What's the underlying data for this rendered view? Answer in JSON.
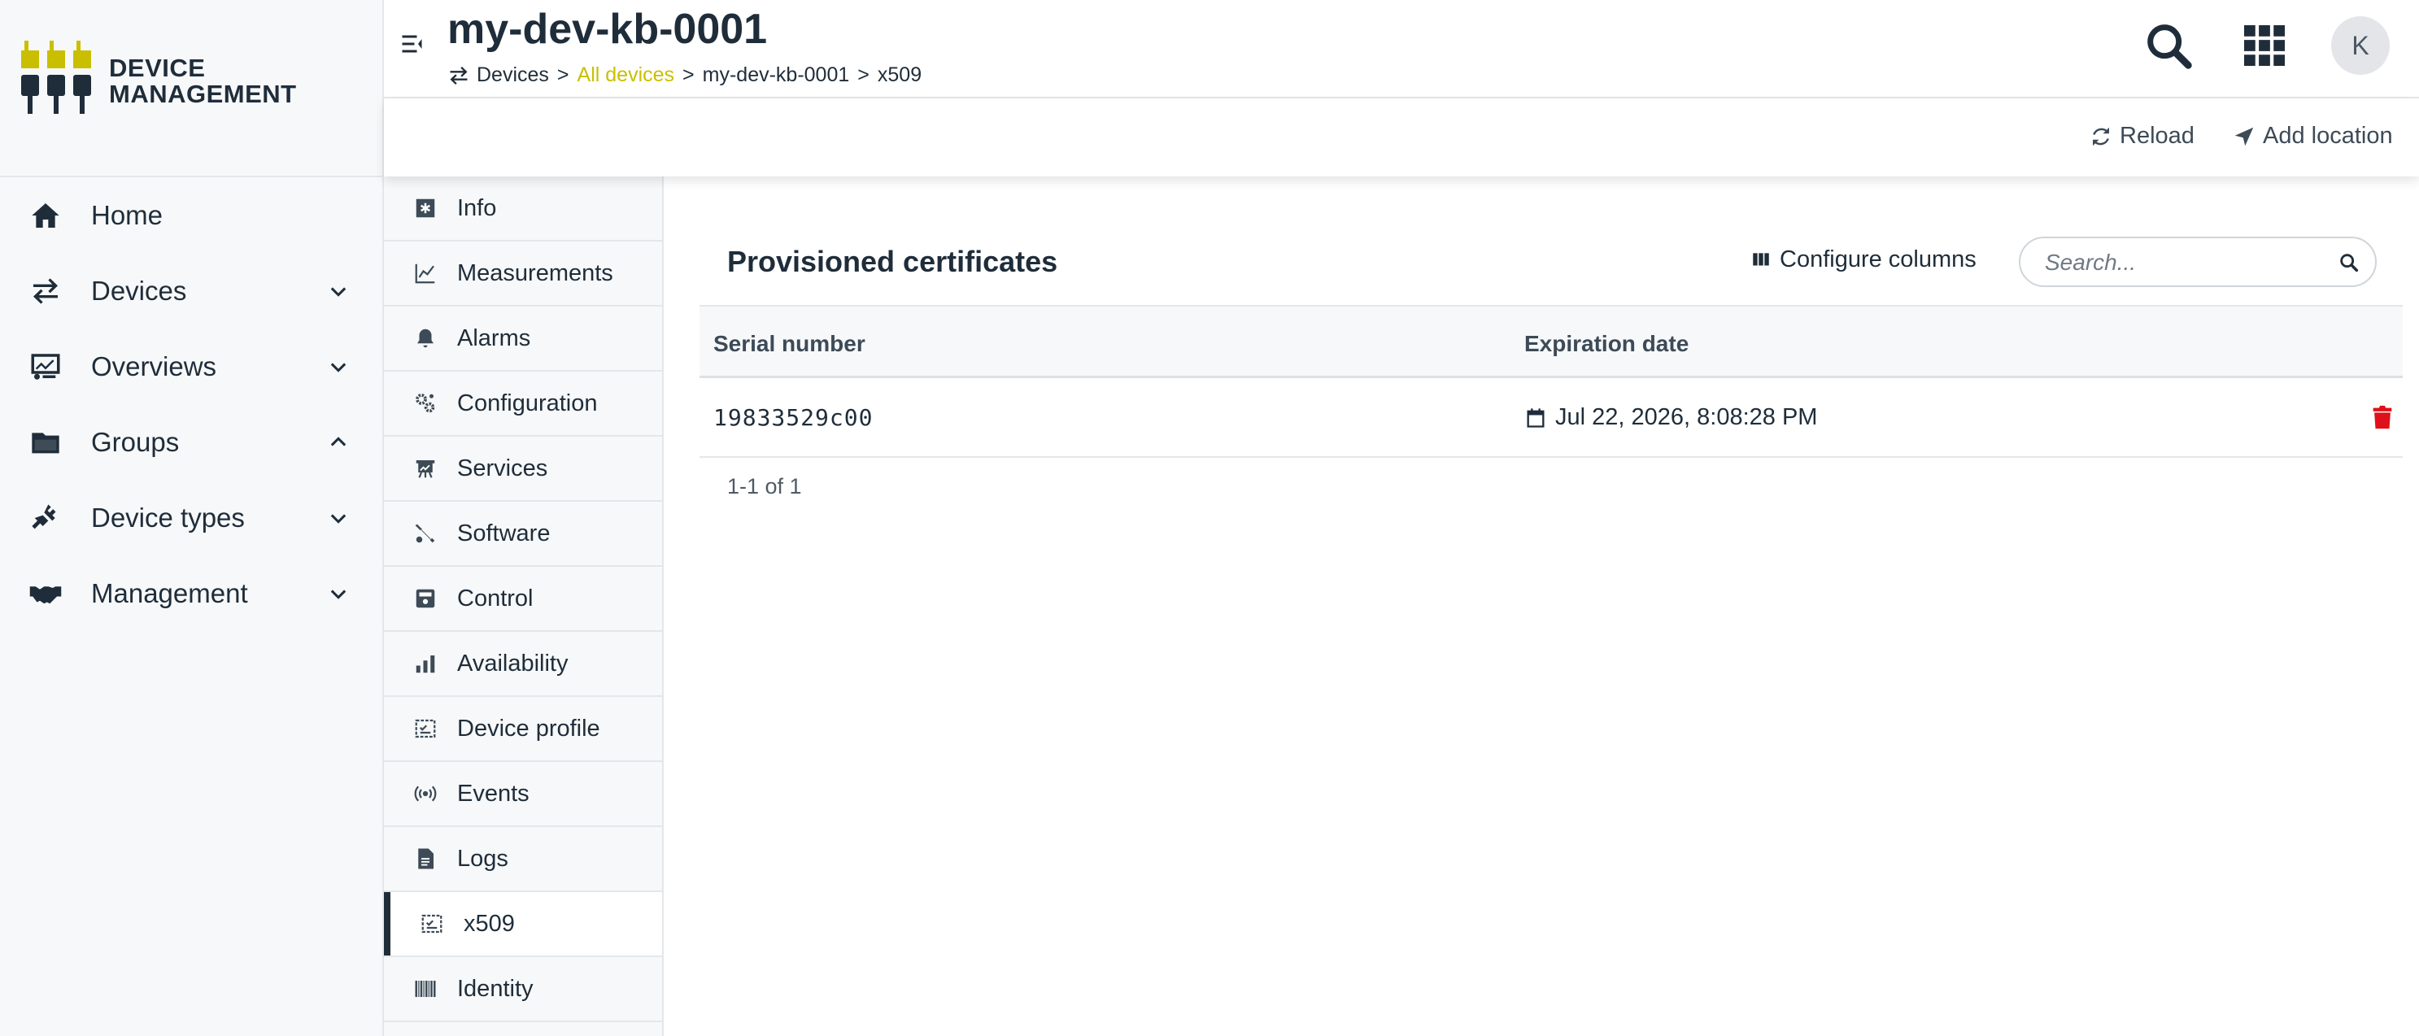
{
  "brand": {
    "line1": "DEVICE",
    "line2": "MANAGEMENT",
    "accent": "#c9bf00"
  },
  "nav": {
    "items": [
      {
        "label": "Home",
        "icon": "home-icon",
        "chevron": ""
      },
      {
        "label": "Devices",
        "icon": "devices-icon",
        "chevron": "down"
      },
      {
        "label": "Overviews",
        "icon": "overviews-icon",
        "chevron": "down"
      },
      {
        "label": "Groups",
        "icon": "folder-icon",
        "chevron": "up"
      },
      {
        "label": "Device types",
        "icon": "plug-icon",
        "chevron": "down"
      },
      {
        "label": "Management",
        "icon": "handshake-icon",
        "chevron": "down"
      }
    ]
  },
  "header": {
    "title": "my-dev-kb-0001",
    "breadcrumb": {
      "root": "Devices",
      "link": "All devices",
      "device": "my-dev-kb-0001",
      "current": "x509",
      "sep": ">"
    },
    "avatar": "K"
  },
  "actions": {
    "reload": "Reload",
    "add_location": "Add location"
  },
  "tabs": {
    "items": [
      {
        "label": "Info",
        "icon": "info-icon"
      },
      {
        "label": "Measurements",
        "icon": "chart-line-icon"
      },
      {
        "label": "Alarms",
        "icon": "bell-icon"
      },
      {
        "label": "Configuration",
        "icon": "gears-icon"
      },
      {
        "label": "Services",
        "icon": "services-icon"
      },
      {
        "label": "Software",
        "icon": "wrench-icon"
      },
      {
        "label": "Control",
        "icon": "control-icon"
      },
      {
        "label": "Availability",
        "icon": "bar-chart-icon"
      },
      {
        "label": "Device profile",
        "icon": "profile-icon"
      },
      {
        "label": "Events",
        "icon": "broadcast-icon"
      },
      {
        "label": "Logs",
        "icon": "document-icon"
      },
      {
        "label": "x509",
        "icon": "certificate-icon"
      },
      {
        "label": "Identity",
        "icon": "barcode-icon"
      }
    ],
    "active_index": 11
  },
  "certificates": {
    "title": "Provisioned certificates",
    "configure_columns": "Configure columns",
    "search_placeholder": "Search...",
    "columns": {
      "serial": "Serial number",
      "expiration": "Expiration date"
    },
    "rows": [
      {
        "serial": "19833529c00",
        "expiration": "Jul 22, 2026, 8:08:28 PM"
      }
    ],
    "pagination": "1-1 of 1",
    "delete_color": "#e0101a"
  }
}
